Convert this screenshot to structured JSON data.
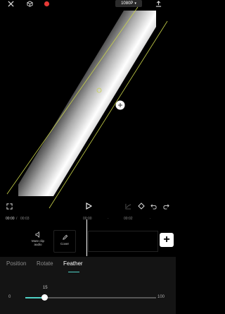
{
  "topbar": {
    "resolution_label": "1080P",
    "icons": [
      "close-icon",
      "cube-icon",
      "record-icon",
      "export-icon"
    ]
  },
  "colors": {
    "accent": "#4fd1c5",
    "mask_line": "#c9d34a",
    "record": "#e53935"
  },
  "timeline": {
    "current_time": "00:00",
    "separator": "/",
    "total_time": "00:03",
    "ticks": [
      "00:00",
      "00:02"
    ],
    "tools": [
      {
        "label": "Mute clip audio",
        "icon": "speaker-icon"
      },
      {
        "label": "Cover",
        "icon": "pencil-icon"
      }
    ]
  },
  "tabs": [
    {
      "label": "Position",
      "active": false
    },
    {
      "label": "Rotate",
      "active": false
    },
    {
      "label": "Feather",
      "active": true
    }
  ],
  "feather": {
    "value": "15",
    "min": "0",
    "max": "100",
    "fraction": 0.15
  }
}
